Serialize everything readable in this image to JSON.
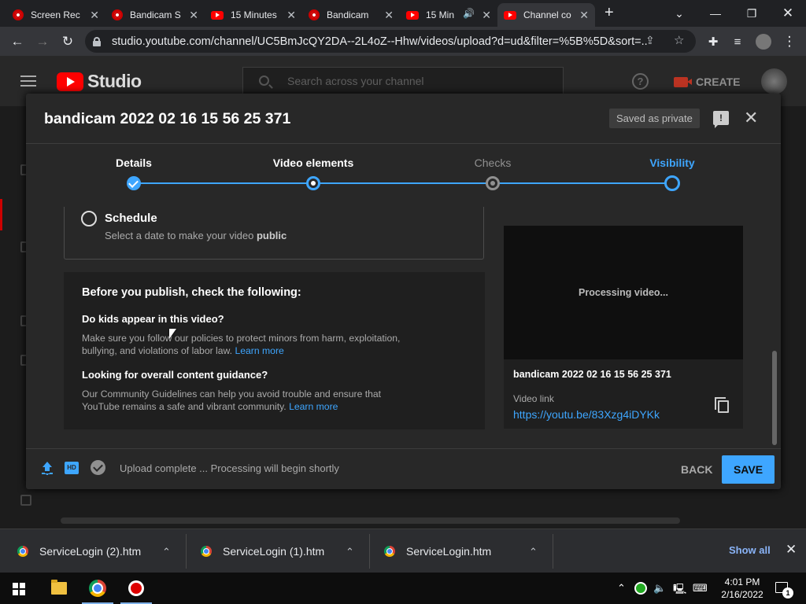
{
  "browser": {
    "tabs": [
      {
        "title": "Screen Rec",
        "icon": "record-icon"
      },
      {
        "title": "Bandicam S",
        "icon": "record-icon"
      },
      {
        "title": "15 Minutes",
        "icon": "youtube-icon"
      },
      {
        "title": "Bandicam",
        "icon": "record-icon"
      },
      {
        "title": "15 Min",
        "icon": "youtube-icon"
      },
      {
        "title": "Channel co",
        "icon": "youtube-icon",
        "active": true
      }
    ],
    "url": "studio.youtube.com/channel/UC5BmJcQY2DA--2L4oZ--Hhw/videos/upload?d=ud&filter=%5B%5D&sort=..."
  },
  "studio": {
    "logo_text": "Studio",
    "search_placeholder": "Search across your channel",
    "create_label": "CREATE"
  },
  "dialog": {
    "title": "bandicam 2022 02 16 15 56 25 371",
    "saved_badge": "Saved as private",
    "steps": [
      {
        "label": "Details",
        "state": "done"
      },
      {
        "label": "Video elements",
        "state": "done"
      },
      {
        "label": "Checks",
        "state": "inactive"
      },
      {
        "label": "Visibility",
        "state": "active"
      }
    ],
    "schedule": {
      "title": "Schedule",
      "subtitle_prefix": "Select a date to make your video",
      "subtitle_bold": "public"
    },
    "checklist": {
      "heading": "Before you publish, check the following:",
      "items": [
        {
          "question": "Do kids appear in this video?",
          "text": "Make sure you follow our policies to protect minors from harm, exploitation, bullying, and violations of labor law.",
          "link": "Learn more"
        },
        {
          "question": "Looking for overall content guidance?",
          "text": "Our Community Guidelines can help you avoid trouble and ensure that YouTube remains a safe and vibrant community.",
          "link": "Learn more"
        }
      ]
    },
    "preview": {
      "status": "Processing video...",
      "title": "bandicam 2022 02 16 15 56 25 371",
      "link_label": "Video link",
      "link": "https://youtu.be/83Xzg4iDYKk"
    },
    "footer": {
      "hd_badge": "HD",
      "status": "Upload complete ... Processing will begin shortly",
      "back_label": "BACK",
      "save_label": "SAVE"
    }
  },
  "downloads": {
    "items": [
      "ServiceLogin (2).htm",
      "ServiceLogin (1).htm",
      "ServiceLogin.htm"
    ],
    "show_all": "Show all"
  },
  "taskbar": {
    "time": "4:01 PM",
    "date": "2/16/2022",
    "notification_count": "1"
  },
  "colors": {
    "accent": "#3ea6ff",
    "dialog_bg": "#282828",
    "brand_red": "#ff0000"
  }
}
